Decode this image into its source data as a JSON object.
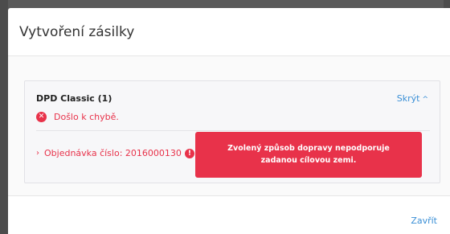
{
  "modal": {
    "title": "Vytvoření zásilky"
  },
  "carrier": {
    "name": "DPD Classic (1)",
    "hide_label": "Skrýt",
    "error_message": "Došlo k chybě.",
    "order_label": "Objednávka číslo: 2016000130"
  },
  "tooltip": {
    "text": "Zvolený způsob dopravy nepodporuje zadanou cílovou zemi."
  },
  "footer": {
    "close_label": "Zavřít"
  },
  "icons": {
    "error": "error-circle-icon",
    "warning": "exclamation-circle-icon",
    "hide_chevron": "chevron-up-icon",
    "row_chevron": "chevron-right-icon"
  },
  "colors": {
    "error": "#e8324a",
    "link": "#3a8fd6"
  }
}
